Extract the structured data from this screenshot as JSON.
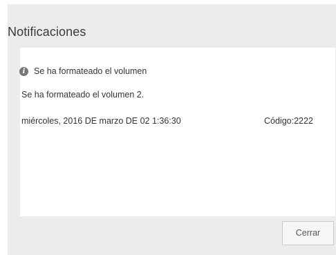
{
  "dialog": {
    "title": "Notificaciones",
    "close_label": "Cerrar"
  },
  "notification": {
    "icon": "info-icon",
    "heading": "Se ha formateado el volumen",
    "body": "Se ha formateado el volumen 2.",
    "date": "miércoles, 2016 DE marzo DE 02 1:36:30",
    "code": "Código:2222"
  }
}
